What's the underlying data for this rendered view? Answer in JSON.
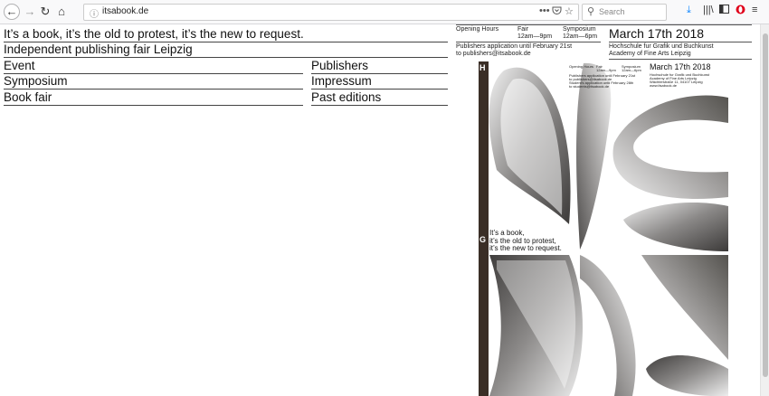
{
  "browser": {
    "url": "itsabook.de",
    "search_placeholder": "Search",
    "icons": [
      "back-arrow-icon",
      "forward-arrow-icon",
      "reload-icon",
      "home-icon",
      "info-icon",
      "more-icon",
      "pocket-icon",
      "bookmark-star-icon",
      "search-icon",
      "download-icon",
      "library-icon",
      "sidebar-icon",
      "opera-icon",
      "menu-icon"
    ]
  },
  "site": {
    "tagline": "It’s a book, it’s the old to protest, it’s the new to request.",
    "subtitle": "Independent publishing fair Leipzig",
    "nav_left": [
      "Event",
      "Symposium",
      "Book fair"
    ],
    "nav_right": [
      "Publishers",
      "Impressum",
      "Past editions"
    ]
  },
  "header": {
    "opening_hours_label": "Opening Hours",
    "fair_label": "Fair",
    "fair_hours": "12am—9pm",
    "symposium_label": "Symposium",
    "symposium_hours": "12am—6pm",
    "publishers_line1": "Publishers application until February 21st",
    "publishers_line2": "to publishers@itsabook.de",
    "date": "March 17th 2018",
    "venue_line1": "Hochschule fur Grafik und Buchkunst",
    "venue_line2": "Academy of Fine Arts Leipzig"
  },
  "poster": {
    "spine_letters": [
      "H",
      "G"
    ],
    "opening_hours_label": "Opening Hours",
    "fair_label": "Fair",
    "fair_hours": "12am—9pm",
    "symposium_label": "Symposium",
    "symposium_hours": "12am—6pm",
    "pub_line1": "Publishers application until February 21st",
    "pub_line2": "to publishers@itsabook.de",
    "stud_line1": "Student's application until February 28th",
    "stud_line2": "to students@itsabook.de",
    "date": "March 17th 2018",
    "venue_line1": "Hochschule fur Grafik und Buchkunst",
    "venue_line2": "Academy of Fine Arts Leipzig",
    "venue_line3": "Wächterstraße 11, 04107 Leipzig",
    "venue_line4": "www.itsabook.de",
    "text_line1": "It’s a book,",
    "text_line2": "it’s the old to protest,",
    "text_line3": "it’s the new to request."
  }
}
